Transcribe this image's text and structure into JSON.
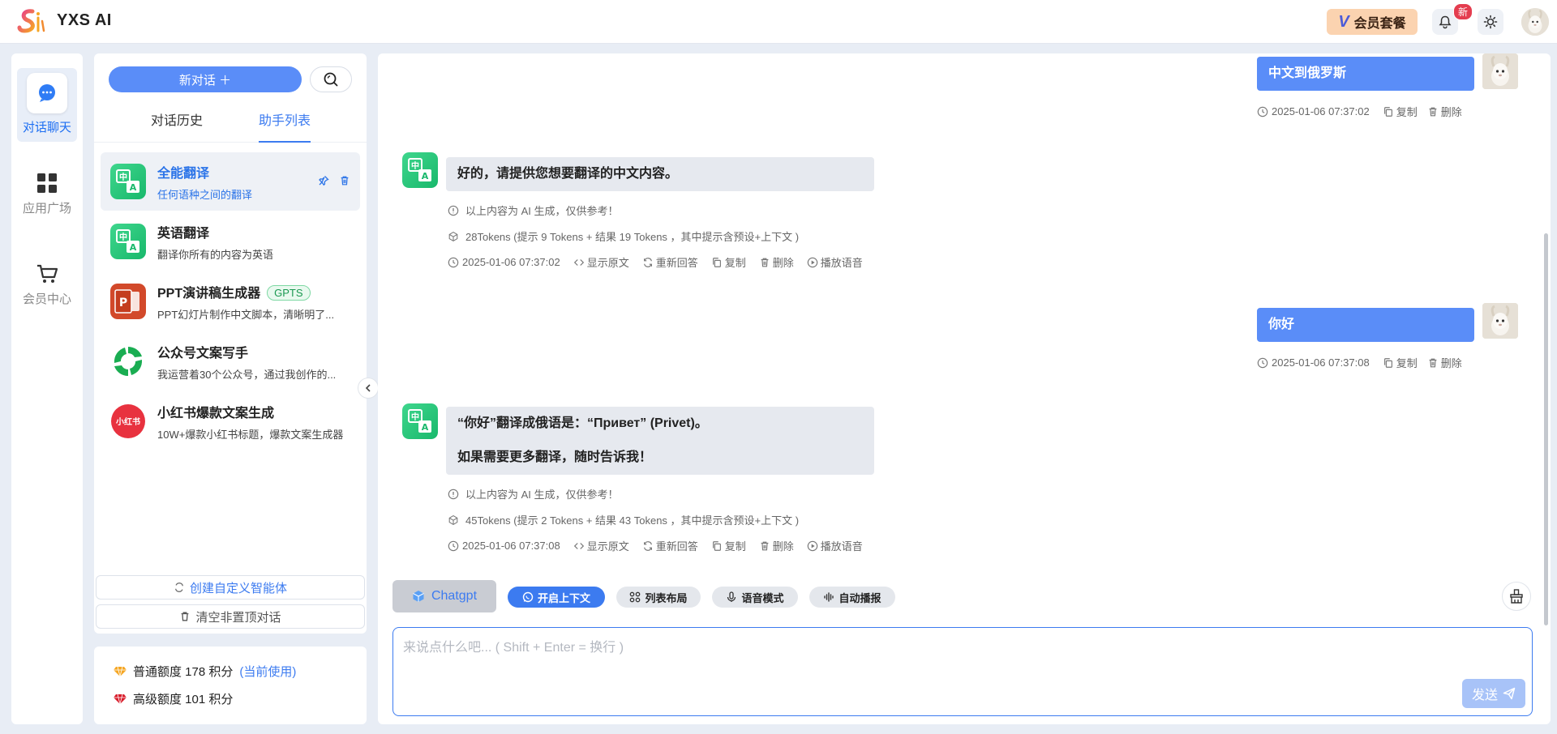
{
  "app": {
    "title": "YXS AI"
  },
  "topbar": {
    "vip_label": "会员套餐",
    "notification_badge": "新"
  },
  "rail": {
    "items": [
      {
        "label": "对话聊天"
      },
      {
        "label": "应用广场"
      },
      {
        "label": "会员中心"
      }
    ]
  },
  "panel": {
    "new_chat_label": "新对话 ＋",
    "tabs": [
      {
        "label": "对话历史"
      },
      {
        "label": "助手列表"
      }
    ],
    "assistants": [
      {
        "name": "全能翻译",
        "desc": "任何语种之间的翻译"
      },
      {
        "name": "英语翻译",
        "desc": "翻译你所有的内容为英语"
      },
      {
        "name": "PPT演讲稿生成器",
        "tag": "GPTS",
        "desc": "PPT幻灯片制作中文脚本，清晰明了..."
      },
      {
        "name": "公众号文案写手",
        "desc": "我运营着30个公众号，通过我创作的..."
      },
      {
        "name": "小红书爆款文案生成",
        "desc": "10W+爆款小红书标题，爆款文案生成器"
      }
    ],
    "create_agent_label": "创建自定义智能体",
    "clear_label": "清空非置顶对话"
  },
  "quota": {
    "normal": "普通额度 178 积分",
    "normal_link": "(当前使用)",
    "premium": "高级额度 101 积分"
  },
  "chat": {
    "messages": [
      {
        "role": "user",
        "text": "中文到俄罗斯",
        "time": "2025-01-06 07:37:02",
        "copy": "复制",
        "delete": "删除"
      },
      {
        "role": "bot",
        "lines": [
          "好的，请提供您想要翻译的中文内容。"
        ],
        "disclaimer": "以上内容为 AI 生成，仅供参考！",
        "tokens": "28Tokens (提示 9 Tokens + 结果 19 Tokens ，其中提示含预设+上下文 )",
        "time": "2025-01-06 07:37:02",
        "show_raw": "显示原文",
        "regen": "重新回答",
        "copy": "复制",
        "delete": "删除",
        "play": "播放语音"
      },
      {
        "role": "user",
        "text": "你好",
        "time": "2025-01-06 07:37:08",
        "copy": "复制",
        "delete": "删除"
      },
      {
        "role": "bot",
        "lines": [
          "“你好”翻译成俄语是：“Привет” (Privet)。",
          "如果需要更多翻译，随时告诉我！"
        ],
        "disclaimer": "以上内容为 AI 生成，仅供参考！",
        "tokens": "45Tokens (提示 2 Tokens + 结果 43 Tokens ，其中提示含预设+上下文 )",
        "time": "2025-01-06 07:37:08",
        "show_raw": "显示原文",
        "regen": "重新回答",
        "copy": "复制",
        "delete": "删除",
        "play": "播放语音"
      }
    ]
  },
  "toolbar": {
    "model_label": "Chatgpt",
    "context_label": "开启上下文",
    "layout_label": "列表布局",
    "voice_label": "语音模式",
    "autoplay_label": "自动播报"
  },
  "input": {
    "placeholder": "来说点什么吧... ( Shift + Enter = 换行 )",
    "send_label": "发送"
  },
  "colors": {
    "primary": "#5a8df8",
    "accent": "#3c7bf0",
    "badge": "#e43d4f"
  },
  "icons": [
    "bell-icon",
    "sun-icon",
    "search-icon",
    "pin-icon",
    "trash-icon",
    "clock-icon",
    "copy-icon",
    "code-icon",
    "refresh-icon",
    "play-icon",
    "cube-icon",
    "info-icon",
    "send-icon",
    "broom-icon"
  ]
}
